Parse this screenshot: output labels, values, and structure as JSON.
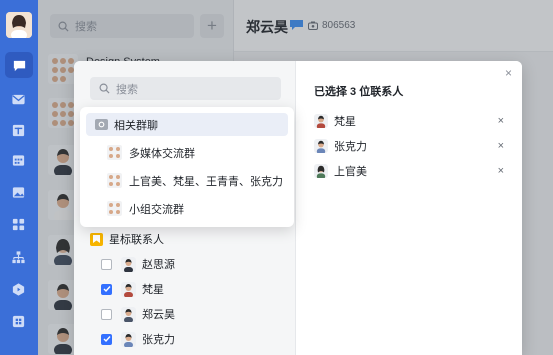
{
  "sidebar": {
    "icons": [
      "chat-icon",
      "mail-icon",
      "doc-icon",
      "calendar-icon",
      "image-icon",
      "apps-icon",
      "org-icon",
      "play-icon",
      "grid-icon"
    ]
  },
  "chat_list": {
    "search_placeholder": "搜索",
    "plus": "+",
    "items": [
      {
        "name": "Design System"
      },
      {
        "name": ""
      },
      {
        "name": ""
      },
      {
        "name": ""
      },
      {
        "name": ""
      },
      {
        "name": ""
      },
      {
        "name": ""
      },
      {
        "name": ""
      }
    ]
  },
  "header": {
    "title": "郑云昊",
    "phone": "806563"
  },
  "modal": {
    "search_placeholder": "搜索",
    "dropdown": {
      "header": "相关群聊",
      "items": [
        "多媒体交流群",
        "上官美、梵星、王青青、张克力",
        "小组交流群"
      ]
    },
    "starred_label": "星标联系人",
    "contacts": [
      {
        "name": "赵思源",
        "checked": false
      },
      {
        "name": "梵星",
        "checked": true
      },
      {
        "name": "郑云昊",
        "checked": false
      },
      {
        "name": "张克力",
        "checked": true
      }
    ],
    "selected_title": "已选择 3 位联系人",
    "selected": [
      {
        "name": "梵星"
      },
      {
        "name": "张克力"
      },
      {
        "name": "上官美"
      }
    ],
    "close": "×",
    "remove": "×"
  },
  "colors": {
    "rail": "#3b6fd8",
    "accent": "#3370ff",
    "star": "#f7b500"
  }
}
